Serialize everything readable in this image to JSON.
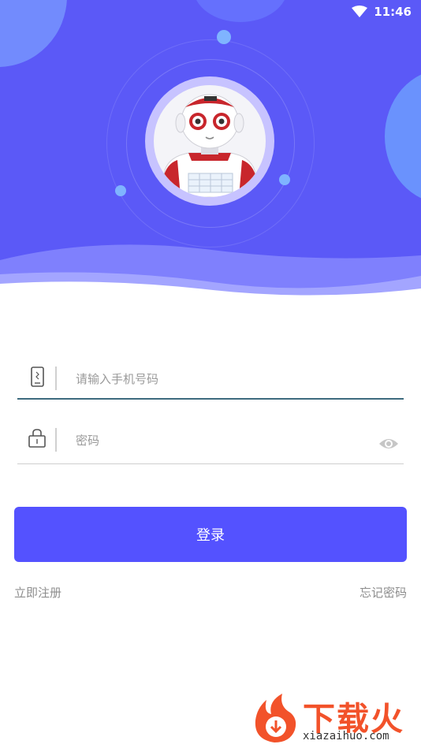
{
  "status_bar": {
    "time": "11:46"
  },
  "login_form": {
    "phone_placeholder": "请输入手机号码",
    "password_placeholder": "密码",
    "login_label": "登录",
    "register_label": "立即注册",
    "forgot_label": "忘记密码"
  },
  "watermark": {
    "title": "下载火",
    "site": "xiazaihuo.com"
  },
  "colors": {
    "header": "#5b59f7",
    "accent": "#5452ff",
    "field_underline_active": "#3d6b7e",
    "link_text": "#8d8d8d",
    "watermark": "#f2522a"
  },
  "icons": {
    "wifi": "wifi-icon",
    "phone": "phone-icon",
    "lock": "lock-icon",
    "eye": "eye-icon",
    "avatar": "robot-avatar",
    "watermark": "flame-logo-icon"
  }
}
